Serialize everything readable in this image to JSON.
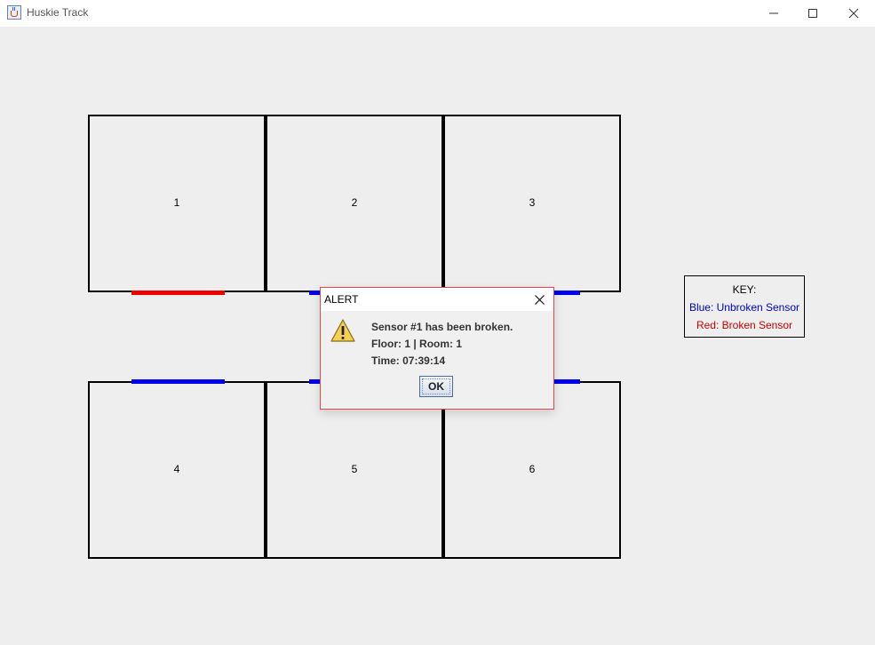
{
  "window": {
    "title": "Huskie Track",
    "icon": "java-cup-icon"
  },
  "floorplan": {
    "rooms": [
      {
        "label": "1"
      },
      {
        "label": "2"
      },
      {
        "label": "3"
      },
      {
        "label": "4"
      },
      {
        "label": "5"
      },
      {
        "label": "6"
      }
    ],
    "sensors": [
      {
        "id": 1,
        "state": "broken",
        "color": "#ee0000"
      },
      {
        "id": 2,
        "state": "unbroken",
        "color": "#0000ee"
      },
      {
        "id": 3,
        "state": "unbroken",
        "color": "#0000ee"
      },
      {
        "id": 4,
        "state": "unbroken",
        "color": "#0000ee"
      },
      {
        "id": 5,
        "state": "unbroken",
        "color": "#0000ee"
      },
      {
        "id": 6,
        "state": "unbroken",
        "color": "#0000ee"
      }
    ]
  },
  "key": {
    "title": "KEY:",
    "blue": "Blue: Unbroken Sensor",
    "red": "Red: Broken Sensor"
  },
  "alert": {
    "title": "ALERT",
    "icon": "warning-icon",
    "message": "Sensor #1 has been broken.",
    "location": "Floor: 1 | Room: 1",
    "time": "Time: 07:39:14",
    "ok_label": "OK"
  }
}
